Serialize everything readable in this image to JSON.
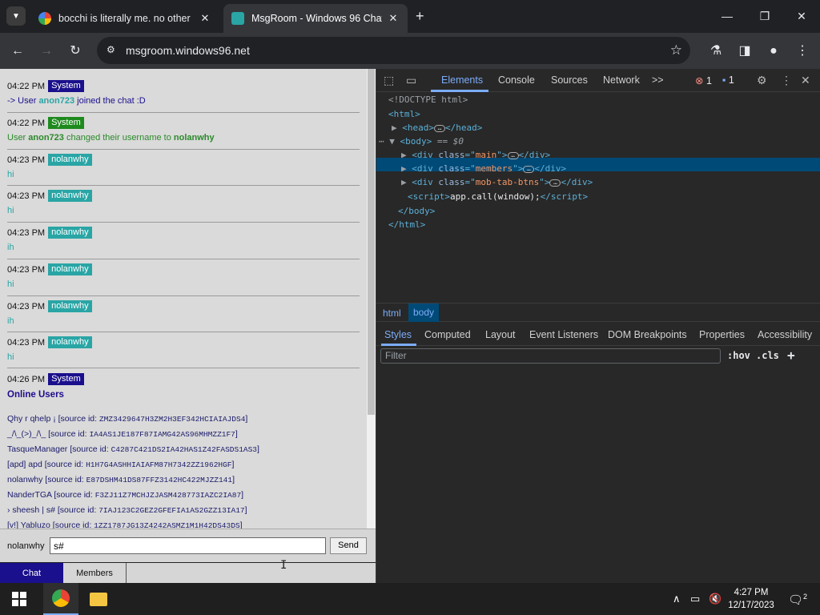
{
  "browser": {
    "tabs": [
      {
        "title": "bocchi is literally me. no other",
        "active": false
      },
      {
        "title": "MsgRoom - Windows 96 Chat",
        "active": true
      }
    ],
    "new_tab": "+",
    "url": "msgroom.windows96.net",
    "window_controls": [
      "minimize",
      "maximize",
      "close"
    ]
  },
  "chat": {
    "messages": [
      {
        "time": "04:22 PM",
        "author": "System",
        "badge_color": "#1a0f8c",
        "text_prefix": "-> User ",
        "user": "anon723",
        "text_suffix": " joined the chat :D"
      },
      {
        "time": "04:22 PM",
        "author": "System",
        "badge_color": "#1e8a1e",
        "text_prefix": "User ",
        "user": "anon723",
        "text_mid": " changed their username to ",
        "user2": "nolanwhy"
      },
      {
        "time": "04:23 PM",
        "author": "nolanwhy",
        "badge_color": "#2aa5a5",
        "text": "hi"
      },
      {
        "time": "04:23 PM",
        "author": "nolanwhy",
        "badge_color": "#2aa5a5",
        "text": "hi"
      },
      {
        "time": "04:23 PM",
        "author": "nolanwhy",
        "badge_color": "#2aa5a5",
        "text": "ih"
      },
      {
        "time": "04:23 PM",
        "author": "nolanwhy",
        "badge_color": "#2aa5a5",
        "text": "hi"
      },
      {
        "time": "04:23 PM",
        "author": "nolanwhy",
        "badge_color": "#2aa5a5",
        "text": "ih"
      },
      {
        "time": "04:23 PM",
        "author": "nolanwhy",
        "badge_color": "#2aa5a5",
        "text": "hi"
      },
      {
        "time": "04:26 PM",
        "author": "System",
        "badge_color": "#1a0f8c"
      }
    ],
    "online_users_title": "Online Users",
    "online_users": [
      {
        "name": "Qhy r qhelp ¡ [source id: ",
        "id": "ZMZ3429647H3ZM2H3EF342HCIAIAJDS4",
        "close": "]"
      },
      {
        "name": "_/\\_(>)_/\\_ [source id: ",
        "id": "IA4AS1JE187F87IAMG42AS96MHMZZ1F7",
        "close": "]"
      },
      {
        "name": "TasqueManager [source id: ",
        "id": "C4287C421DS2IA42HAS1Z42FASDS1AS3",
        "close": "]"
      },
      {
        "name": "[apd] apd [source id: ",
        "id": "H1H7G4ASHHIAIAFM87H7342ZZ1962HGF",
        "close": "]"
      },
      {
        "name": "nolanwhy [source id: ",
        "id": "E87DSHM41DS87FFZ3142HC422MJZZ141",
        "close": "]"
      },
      {
        "name": "NanderTGA [source id: ",
        "id": "F3ZJ11Z7MCHJZJASM428773IAZC2IA87",
        "close": "]"
      },
      {
        "name": "› sheesh | s# [source id: ",
        "id": "7IAJ123C2GEZ2GFEFIA1AS2GZZ13IA17",
        "close": "]"
      },
      {
        "name": "[v!] Yabluzo [source id: ",
        "id": "1ZZ1787JG13Z4242ASMZ1M1H42DS43DS",
        "close": "]"
      }
    ],
    "username_label": "nolanwhy",
    "input_value": "s#",
    "send_label": "Send",
    "tabs": [
      "Chat",
      "Members"
    ]
  },
  "devtools": {
    "tabs": [
      "Elements",
      "Console",
      "Sources",
      "Network"
    ],
    "more": ">>",
    "error_count": "1",
    "info_count": "1",
    "dom": {
      "doctype": "<!DOCTYPE html>",
      "html_open": "<html>",
      "head": "<head>",
      "head_close": "</head>",
      "body_open": "<body>",
      "body_marker": "== $0",
      "div1_class": "main",
      "div2_class": "members",
      "div3_class": "mob-tab-btns",
      "script_text": "app.call(window);",
      "body_close": "</body>",
      "html_close": "</html>"
    },
    "breadcrumbs": [
      "html",
      "body"
    ],
    "style_tabs": [
      "Styles",
      "Computed",
      "Layout",
      "Event Listeners",
      "DOM Breakpoints",
      "Properties",
      "Accessibility"
    ],
    "filter_placeholder": "Filter",
    "hov": ":hov",
    "cls": ".cls",
    "add": "+"
  },
  "taskbar": {
    "time": "4:27 PM",
    "date": "12/17/2023",
    "notification_count": "2"
  }
}
